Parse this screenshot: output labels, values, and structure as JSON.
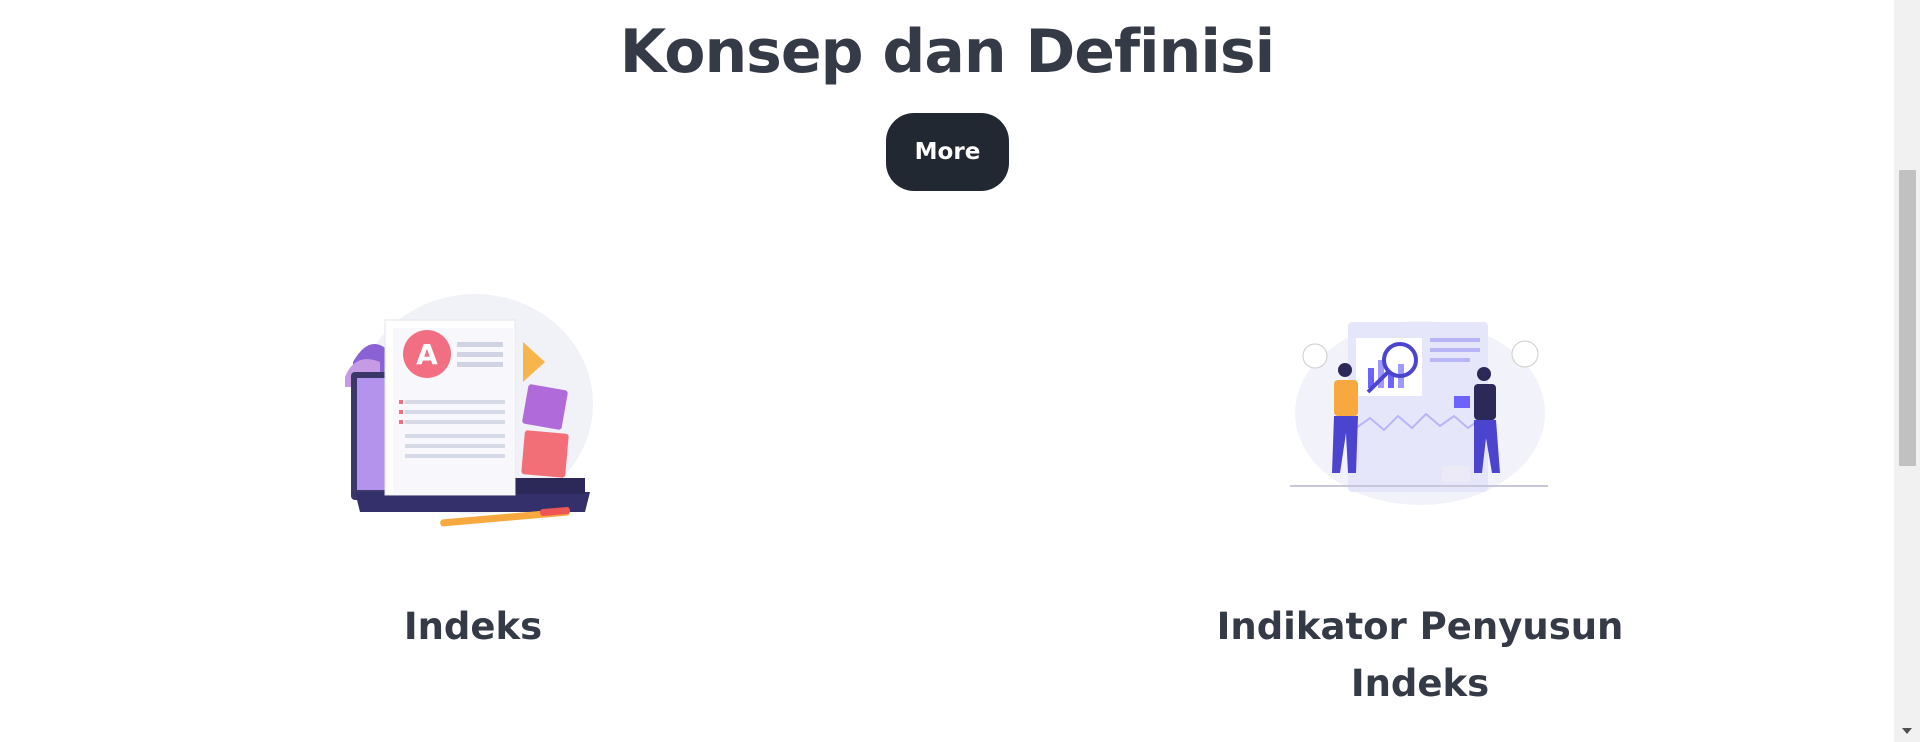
{
  "section": {
    "title": "Konsep dan Definisi",
    "more_label": "More"
  },
  "cards": [
    {
      "title": "Indeks",
      "illustration": "document-laptop-illustration"
    },
    {
      "title": "Indikator Penyusun Indeks",
      "illustration": "data-analysis-people-illustration"
    }
  ],
  "colors": {
    "text": "#343a46",
    "button_bg": "#222831",
    "button_text": "#ffffff",
    "accent_purple": "#6c63ff"
  },
  "scrollbar": {
    "icons": [
      "chevron-down-icon"
    ]
  }
}
